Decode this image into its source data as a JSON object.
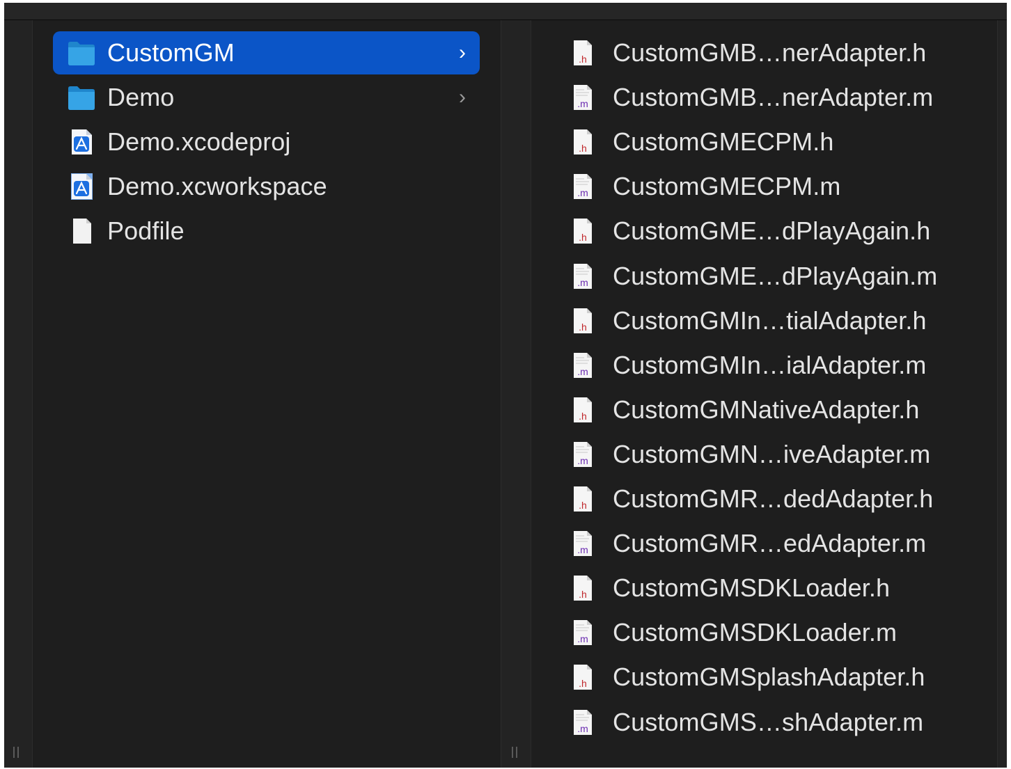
{
  "colors": {
    "window_bg": "#1e1e1e",
    "selection": "#0b55c7",
    "text": "#e4e4e4",
    "folder_blue": "#36a4e6"
  },
  "column1": {
    "items": [
      {
        "label": "CustomGM",
        "icon": "folder-icon",
        "selected": true,
        "has_children": true,
        "chevron": "›"
      },
      {
        "label": "Demo",
        "icon": "folder-icon",
        "selected": false,
        "has_children": true,
        "chevron": "›"
      },
      {
        "label": "Demo.xcodeproj",
        "icon": "xcodeproj-icon",
        "selected": false,
        "has_children": false
      },
      {
        "label": "Demo.xcworkspace",
        "icon": "xcworkspace-icon",
        "selected": false,
        "has_children": false
      },
      {
        "label": "Podfile",
        "icon": "document-icon",
        "selected": false,
        "has_children": false
      }
    ]
  },
  "column2": {
    "items": [
      {
        "label": "CustomGMB…nerAdapter.h",
        "ext": ".h"
      },
      {
        "label": "CustomGMB…nerAdapter.m",
        "ext": ".m"
      },
      {
        "label": "CustomGMECPM.h",
        "ext": ".h"
      },
      {
        "label": "CustomGMECPM.m",
        "ext": ".m"
      },
      {
        "label": "CustomGME…dPlayAgain.h",
        "ext": ".h"
      },
      {
        "label": "CustomGME…dPlayAgain.m",
        "ext": ".m"
      },
      {
        "label": "CustomGMIn…tialAdapter.h",
        "ext": ".h"
      },
      {
        "label": "CustomGMIn…ialAdapter.m",
        "ext": ".m"
      },
      {
        "label": "CustomGMNativeAdapter.h",
        "ext": ".h"
      },
      {
        "label": "CustomGMN…iveAdapter.m",
        "ext": ".m"
      },
      {
        "label": "CustomGMR…dedAdapter.h",
        "ext": ".h"
      },
      {
        "label": "CustomGMR…edAdapter.m",
        "ext": ".m"
      },
      {
        "label": "CustomGMSDKLoader.h",
        "ext": ".h"
      },
      {
        "label": "CustomGMSDKLoader.m",
        "ext": ".m"
      },
      {
        "label": "CustomGMSplashAdapter.h",
        "ext": ".h"
      },
      {
        "label": "CustomGMS…shAdapter.m",
        "ext": ".m"
      }
    ]
  }
}
